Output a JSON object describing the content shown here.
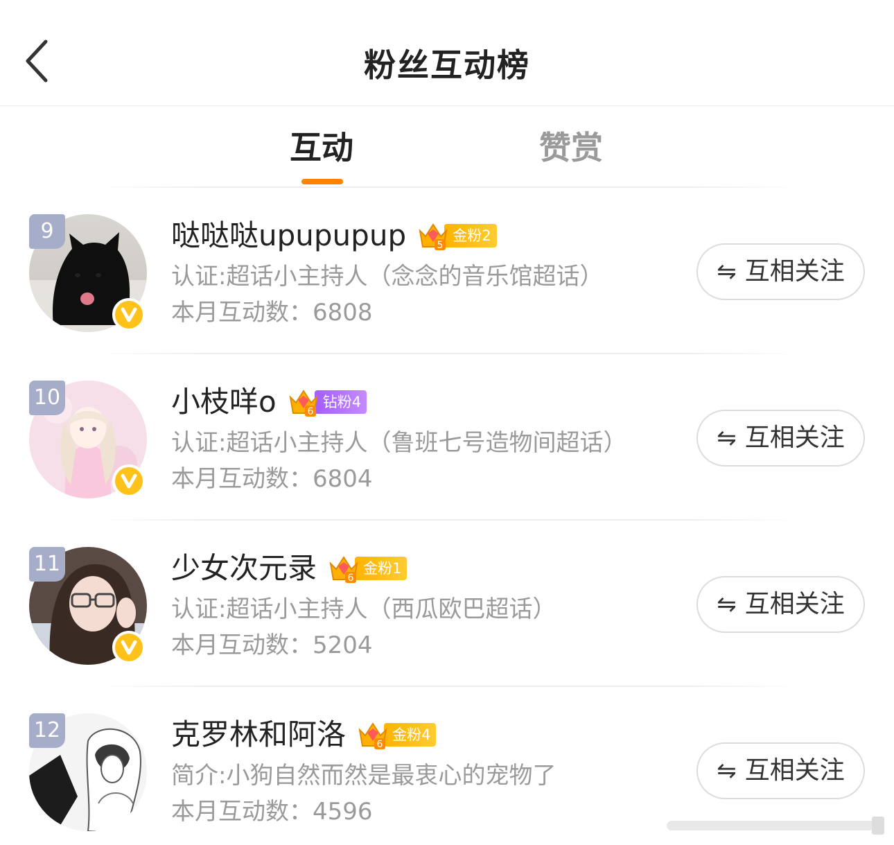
{
  "header": {
    "title": "粉丝互动榜",
    "back_icon": "chevron-left-icon"
  },
  "tabs": [
    {
      "label": "互动",
      "active": true
    },
    {
      "label": "赞赏",
      "active": false
    }
  ],
  "colors": {
    "accent": "#ff8200",
    "rank_badge": "#a6adc8",
    "verified": "#ffc21a",
    "gold_badge": "#ffb300",
    "diamond_badge": "#a45cff"
  },
  "list": [
    {
      "rank": "9",
      "name": "哒哒哒upupupup",
      "badge_level": "5",
      "badge_label": "金粉2",
      "badge_type": "gold",
      "desc": "认证:超话小主持人（念念的音乐馆超话）",
      "count_label": "本月互动数：",
      "count": "6808",
      "follow_label": "互相关注",
      "follow_icon": "mutual-follow-icon",
      "verified": true
    },
    {
      "rank": "10",
      "name": "小枝咩o",
      "badge_level": "6",
      "badge_label": "钻粉4",
      "badge_type": "diamond",
      "desc": "认证:超话小主持人（鲁班七号造物间超话）",
      "count_label": "本月互动数：",
      "count": "6804",
      "follow_label": "互相关注",
      "follow_icon": "mutual-follow-icon",
      "verified": true
    },
    {
      "rank": "11",
      "name": "少女次元录",
      "badge_level": "6",
      "badge_label": "金粉1",
      "badge_type": "gold",
      "desc": "认证:超话小主持人（西瓜欧巴超话）",
      "count_label": "本月互动数：",
      "count": "5204",
      "follow_label": "互相关注",
      "follow_icon": "mutual-follow-icon",
      "verified": true
    },
    {
      "rank": "12",
      "name": "克罗林和阿洛",
      "badge_level": "6",
      "badge_label": "金粉4",
      "badge_type": "gold",
      "desc": "简介:小狗自然而然是最衷心的宠物了",
      "count_label": "本月互动数：",
      "count": "4596",
      "follow_label": "互相关注",
      "follow_icon": "mutual-follow-icon",
      "verified": false
    }
  ]
}
